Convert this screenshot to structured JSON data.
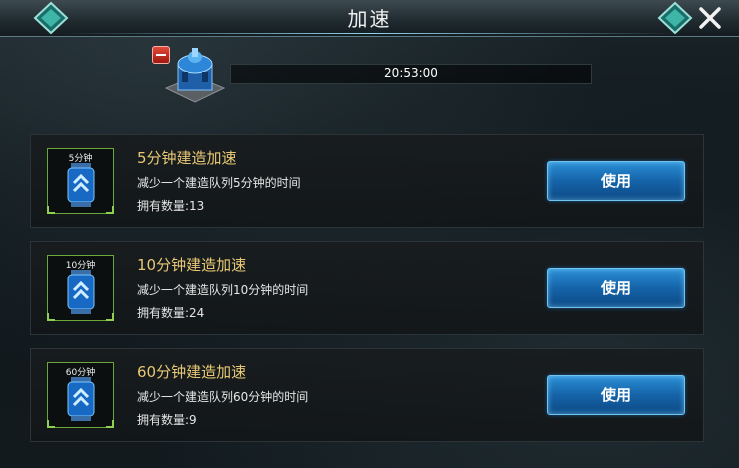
{
  "header": {
    "title": "加速"
  },
  "timer": {
    "remaining": "20:53:00"
  },
  "items": [
    {
      "icon_label": "5分钟",
      "name": "5分钟建造加速",
      "description": "减少一个建造队列5分钟的时间",
      "count": "拥有数量:13",
      "button_label": "使用"
    },
    {
      "icon_label": "10分钟",
      "name": "10分钟建造加速",
      "description": "减少一个建造队列10分钟的时间",
      "count": "拥有数量:24",
      "button_label": "使用"
    },
    {
      "icon_label": "60分钟",
      "name": "60分钟建造加速",
      "description": "减少一个建造队列60分钟的时间",
      "count": "拥有数量:9",
      "button_label": "使用"
    }
  ],
  "colors": {
    "item_name": "#e8c874",
    "button": "#1563a8",
    "icon_border": "#6aa838"
  },
  "icons": [
    "gem-icon",
    "close-icon",
    "minus-icon",
    "building-icon",
    "speedup-canister-icon"
  ]
}
